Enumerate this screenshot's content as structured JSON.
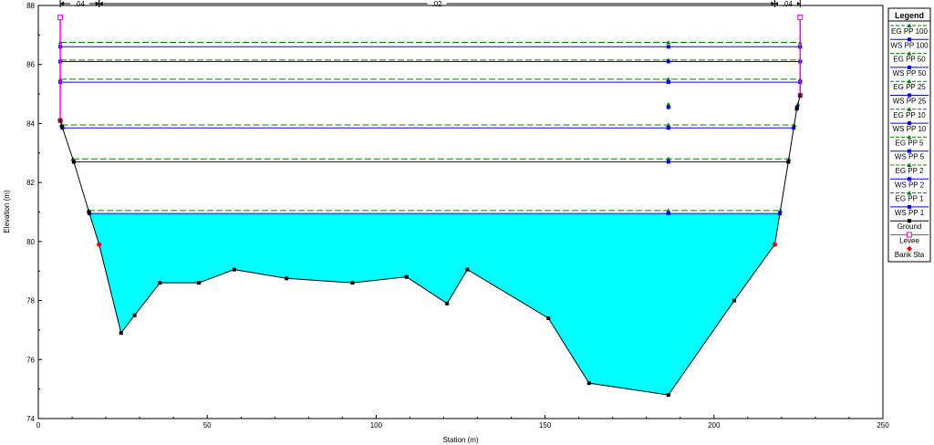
{
  "chart_data": {
    "type": "line",
    "xlabel": "Station (m)",
    "ylabel": "Elevation (m)",
    "xlim": [
      0,
      250
    ],
    "ylim": [
      74,
      88
    ],
    "xticks": [
      0,
      50,
      100,
      150,
      200,
      250
    ],
    "yticks": [
      74,
      76,
      78,
      80,
      82,
      84,
      86,
      88
    ],
    "xtick_labels": [
      "0",
      "50",
      "100",
      "150",
      "200",
      "250"
    ],
    "ytick_labels": [
      "74",
      "76",
      "78",
      "80",
      "82",
      "84",
      "86",
      "88"
    ],
    "legend_position": "right",
    "legend_title": "Legend",
    "manning_n": [
      {
        "label": ".04",
        "x_from": 6.5,
        "x_to": 18
      },
      {
        "label": ".02",
        "x_from": 18,
        "x_to": 218
      },
      {
        "label": ".04",
        "x_from": 218,
        "x_to": 225.5
      }
    ],
    "ground": {
      "name": "Ground",
      "x": [
        6.5,
        7,
        10.5,
        15,
        18,
        24.5,
        28.5,
        36,
        47.5,
        58,
        73.5,
        93,
        109,
        121,
        127,
        151,
        163,
        186.5,
        206,
        218,
        222,
        224.5,
        225.5
      ],
      "y": [
        84.1,
        83.9,
        82.7,
        81,
        79.9,
        76.9,
        77.5,
        78.6,
        78.6,
        79.05,
        78.75,
        78.6,
        78.8,
        77.9,
        79.05,
        77.4,
        75.2,
        74.8,
        78,
        79.9,
        82.7,
        84.5,
        84.95
      ],
      "color": "#000000"
    },
    "levee": {
      "name": "Levee",
      "left": {
        "x": 6.5,
        "y": [
          84.1,
          87.6
        ]
      },
      "right": {
        "x": 225.5,
        "y": [
          84.95,
          87.6
        ]
      },
      "color": "#ff00ff"
    },
    "bank_stations": {
      "name": "Bank Sta",
      "x": [
        18,
        218
      ],
      "y": [
        79.9,
        79.9
      ],
      "color": "#ff0000"
    },
    "fill_color": "#00ffff",
    "profiles": [
      {
        "name": "EG PP 100",
        "kind": "EG",
        "elev": 86.75,
        "color": "#008000"
      },
      {
        "name": "WS PP 100",
        "kind": "WS",
        "elev": 86.6,
        "color": "#0000ff"
      },
      {
        "name": "EG PP 50",
        "kind": "EG",
        "elev": 86.15,
        "color": "#008000"
      },
      {
        "name": "WS PP 50",
        "kind": "WS",
        "elev": 86.1,
        "color": "#0000ff"
      },
      {
        "name": "EG PP 25",
        "kind": "EG",
        "elev": 85.5,
        "color": "#008000"
      },
      {
        "name": "WS PP 25",
        "kind": "WS",
        "elev": 85.4,
        "color": "#0000ff"
      },
      {
        "name": "EG PP 10",
        "kind": "EG",
        "elev": 84.65,
        "color": "#008000"
      },
      {
        "name": "WS PP 10",
        "kind": "WS",
        "elev": 84.55,
        "color": "#0000ff"
      },
      {
        "name": "EG PP 5",
        "kind": "EG",
        "elev": 83.95,
        "color": "#008000"
      },
      {
        "name": "WS PP 5",
        "kind": "WS",
        "elev": 83.85,
        "color": "#0000ff"
      },
      {
        "name": "EG PP 2",
        "kind": "EG",
        "elev": 82.8,
        "color": "#008000"
      },
      {
        "name": "WS PP 2",
        "kind": "WS",
        "elev": 82.7,
        "color": "#0000ff"
      },
      {
        "name": "EG PP 1",
        "kind": "EG",
        "elev": 81.05,
        "color": "#008000"
      },
      {
        "name": "WS PP 1",
        "kind": "WS",
        "elev": 80.95,
        "color": "#0000ff"
      }
    ],
    "profile_marker_station": 186.5,
    "filled_profile": "WS PP 1"
  }
}
